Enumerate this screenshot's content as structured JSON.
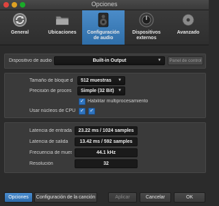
{
  "window": {
    "title": "Opciones"
  },
  "tabs": [
    {
      "label": "General",
      "icon": "refresh-arrows-icon"
    },
    {
      "label": "Ubicaciones",
      "icon": "folder-icon"
    },
    {
      "label": "Configuración de audio",
      "icon": "speaker-icon",
      "active": true
    },
    {
      "label": "Dispositivos externos",
      "icon": "knob-icon"
    },
    {
      "label": "Avanzado",
      "icon": "gear-icon"
    }
  ],
  "audio_device": {
    "label": "Dispositivo de audio",
    "value": "Built-in Output",
    "control_panel_button": "Panel de control"
  },
  "settings": {
    "block_size": {
      "label": "Tamaño de bloque d",
      "value": "512 muestras"
    },
    "precision": {
      "label": "Precisión de proces",
      "value": "Simple (32 Bit)"
    },
    "multiprocessing": {
      "label": "Habilitar multiprocesamiento",
      "checked": true
    },
    "cpu_cores": {
      "label": "Usar núcleos de CPU",
      "checked": [
        true,
        true
      ]
    }
  },
  "readouts": {
    "input_latency": {
      "label": "Latencia de entrada",
      "value": "23.22 ms / 1024 samples"
    },
    "output_latency": {
      "label": "Latencia de salida",
      "value": "13.42 ms / 592 samples"
    },
    "sample_rate": {
      "label": "Frecuencia de mues",
      "value": "44.1 kHz"
    },
    "resolution": {
      "label": "Resolución",
      "value": "32"
    }
  },
  "bottom": {
    "options": "Opciones",
    "song_config": "Configuración de la canción",
    "apply": "Aplicar",
    "cancel": "Cancelar",
    "ok": "OK"
  },
  "colors": {
    "accent": "#3a7dc0",
    "background": "#2b2b2b",
    "panel": "#3a3a3a"
  }
}
